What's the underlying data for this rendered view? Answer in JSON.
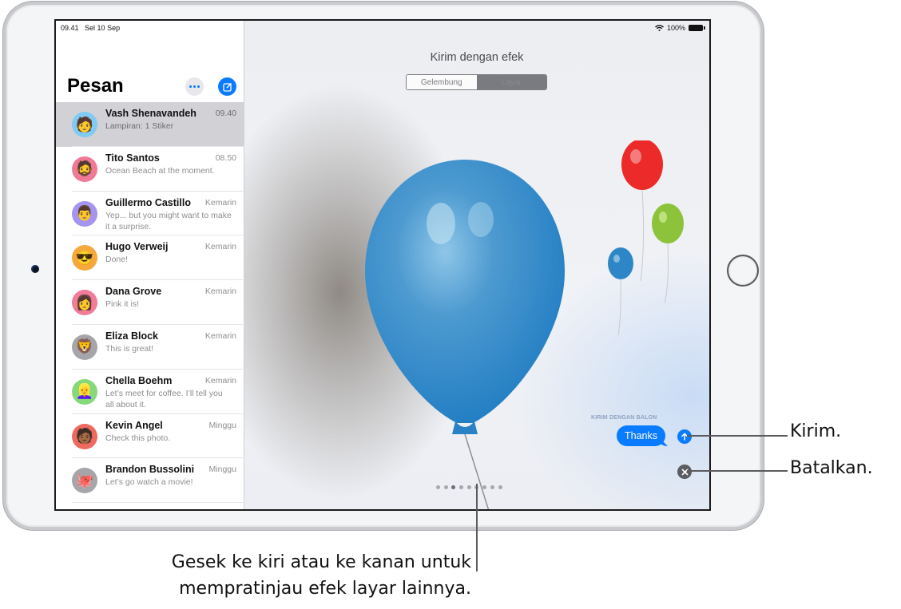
{
  "status_bar": {
    "time": "09.41",
    "date": "Sel 10 Sep",
    "battery": "100%"
  },
  "sidebar": {
    "title": "Pesan",
    "more_icon": "ellipsis-icon",
    "compose_icon": "compose-icon",
    "conversations": [
      {
        "name": "Vash Shenavandeh",
        "time": "09.40",
        "preview": "Lampiran: 1 Stiker",
        "avatar_color": "#7fcbf3",
        "avatar_emoji": "🧑",
        "selected": true
      },
      {
        "name": "Tito Santos",
        "time": "08.50",
        "preview": "Ocean Beach at the moment.",
        "avatar_color": "#f07a95",
        "avatar_emoji": "🧔"
      },
      {
        "name": "Guillermo Castillo",
        "time": "Kemarin",
        "preview": "Yep... but you might want to make it a surprise.",
        "avatar_color": "#a594f0",
        "avatar_emoji": "👨"
      },
      {
        "name": "Hugo Verweij",
        "time": "Kemarin",
        "preview": "Done!",
        "avatar_color": "#f5a83c",
        "avatar_emoji": "😎"
      },
      {
        "name": "Dana Grove",
        "time": "Kemarin",
        "preview": "Pink it is!",
        "avatar_color": "#f27c98",
        "avatar_emoji": "👩"
      },
      {
        "name": "Eliza Block",
        "time": "Kemarin",
        "preview": "This is great!",
        "avatar_color": "#a6a6aa",
        "avatar_emoji": "🦁"
      },
      {
        "name": "Chella Boehm",
        "time": "Kemarin",
        "preview": "Let’s meet for coffee. I’ll tell you all about it.",
        "avatar_color": "#86d87a",
        "avatar_emoji": "👱‍♀️"
      },
      {
        "name": "Kevin Angel",
        "time": "Minggu",
        "preview": "Check this photo.",
        "avatar_color": "#f0695e",
        "avatar_emoji": "🧑🏾"
      },
      {
        "name": "Brandon Bussolini",
        "time": "Minggu",
        "preview": "Let’s go watch a movie!",
        "avatar_color": "#a6a6aa",
        "avatar_emoji": "🐙"
      }
    ]
  },
  "effects": {
    "title": "Kirim dengan efek",
    "segments": [
      {
        "label": "Gelembung",
        "selected": false
      },
      {
        "label": "Layar",
        "selected": true
      }
    ],
    "effect_label": "KIRIM DENGAN BALON",
    "message_text": "Thanks",
    "page_count": 9,
    "active_page": 3,
    "send_icon": "arrow-up-icon",
    "cancel_icon": "close-icon",
    "balloon_colors": {
      "big": "#2a84c9",
      "red": "#ec2a2a",
      "green": "#8cc33a",
      "blue_small": "#2f86c6"
    }
  },
  "callouts": {
    "send": "Kirim.",
    "cancel": "Batalkan.",
    "swipe_line1": "Gesek ke kiri atau ke kanan untuk",
    "swipe_line2": "mempratinjau efek layar lainnya."
  },
  "colors": {
    "accent": "#0a7aff",
    "selected_row": "#d1d1d6",
    "cancel_button": "#5c5d62"
  }
}
